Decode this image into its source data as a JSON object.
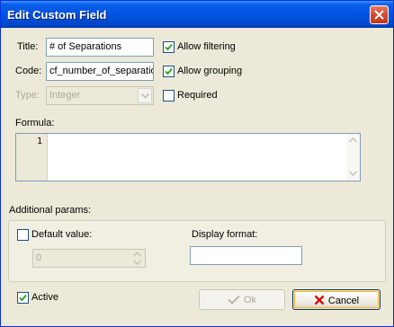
{
  "window": {
    "title": "Edit Custom Field"
  },
  "form": {
    "title_label": "Title:",
    "title_value": "# of  Separations",
    "code_label": "Code:",
    "code_value": "cf_number_of_separatio",
    "type_label": "Type:",
    "type_value": "Integer",
    "allow_filtering": {
      "label": "Allow filtering",
      "checked": true
    },
    "allow_grouping": {
      "label": "Allow grouping",
      "checked": true
    },
    "required": {
      "label": "Required",
      "checked": false
    },
    "formula_label": "Formula:",
    "formula_line_number": "1"
  },
  "additional": {
    "label": "Additional params:",
    "default_value": {
      "label": "Default value:",
      "checked": false,
      "value": "0"
    },
    "display_format": {
      "label": "Display format:",
      "value": ""
    }
  },
  "footer": {
    "active": {
      "label": "Active",
      "checked": true
    },
    "ok_label": "Ok",
    "cancel_label": "Cancel"
  },
  "colors": {
    "title_bar": "#0054e3",
    "check_mark": "#21a121",
    "cancel_x": "#d01010",
    "dialog_bg": "#ece9d8"
  }
}
